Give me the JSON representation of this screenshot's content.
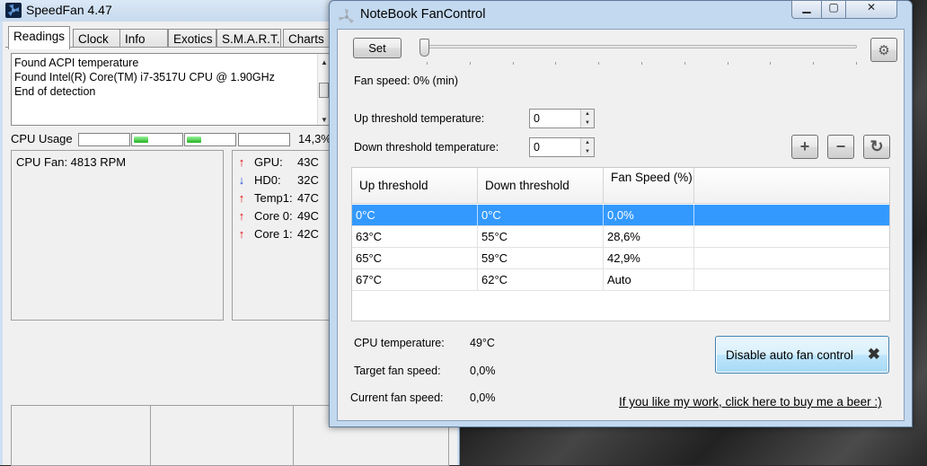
{
  "speedfan": {
    "title": "SpeedFan 4.47",
    "tabs": [
      "Readings",
      "Clock",
      "Info",
      "Exotics",
      "S.M.A.R.T.",
      "Charts"
    ],
    "active_tab": "Readings",
    "log_lines": [
      "Found ACPI temperature",
      "Found Intel(R) Core(TM) i7-3517U CPU @ 1.90GHz",
      "End of detection"
    ],
    "cpu_usage_label": "CPU Usage",
    "cpu_usage_percent": "14,3%",
    "cpu_core_bars": [
      0.0,
      0.3,
      0.3,
      0.0
    ],
    "fans": [
      "CPU Fan: 4813 RPM"
    ],
    "temps": [
      {
        "label": "GPU:",
        "value": "43C",
        "trend": "up"
      },
      {
        "label": "HD0:",
        "value": "32C",
        "trend": "down"
      },
      {
        "label": "Temp1:",
        "value": "47C",
        "trend": "up"
      },
      {
        "label": "Core 0:",
        "value": "49C",
        "trend": "up"
      },
      {
        "label": "Core 1:",
        "value": "42C",
        "trend": "up"
      }
    ]
  },
  "nbfc": {
    "title": "NoteBook FanControl",
    "set_label": "Set",
    "fan_speed_text": "Fan speed: 0% (min)",
    "fan_slider_percent": 0,
    "up_threshold_label": "Up threshold temperature:",
    "up_threshold_value": "0",
    "down_threshold_label": "Down threshold temperature:",
    "down_threshold_value": "0",
    "table": {
      "headers": [
        "Up threshold",
        "Down threshold",
        "Fan Speed (%)"
      ],
      "rows": [
        [
          "0°C",
          "0°C",
          "0,0%"
        ],
        [
          "63°C",
          "55°C",
          "28,6%"
        ],
        [
          "65°C",
          "59°C",
          "42,9%"
        ],
        [
          "67°C",
          "62°C",
          "Auto"
        ]
      ],
      "selected_row": 0
    },
    "cpu_temp_label": "CPU temperature:",
    "cpu_temp_value": "49°C",
    "target_fan_label": "Target fan speed:",
    "target_fan_value": "0,0%",
    "current_fan_label": "Current fan speed:",
    "current_fan_value": "0,0%",
    "disable_button_label": "Disable auto fan control",
    "beer_link": "If you like my work, click here to buy me a beer :)"
  }
}
